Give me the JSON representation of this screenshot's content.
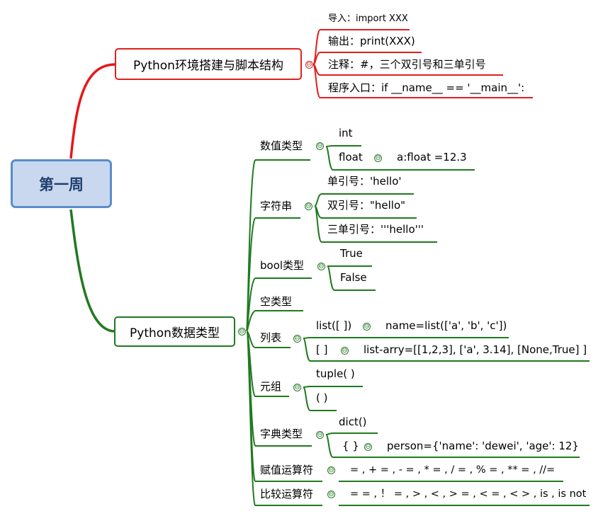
{
  "root": {
    "label": "第一周"
  },
  "branch1": {
    "label": "Python环境搭建与脚本结构",
    "items": [
      "导入：import XXX",
      "输出：print(XXX)",
      "注释：#，三个双引号和三单引号",
      "程序入口：if __name__ == '__main__':"
    ]
  },
  "branch2": {
    "label": "Python数据类型",
    "numeric": {
      "label": "数值类型",
      "int": "int",
      "float": "float",
      "float_example": "a:float =12.3"
    },
    "string": {
      "label": "字符串",
      "single": "单引号：'hello'",
      "double": "双引号：\"hello\"",
      "triple": "三单引号：'''hello'''"
    },
    "bool": {
      "label": "bool类型",
      "true": "True",
      "false": "False"
    },
    "none": {
      "label": "空类型"
    },
    "list": {
      "label": "列表",
      "ctor": "list([ ])",
      "ctor_example": "name=list(['a', 'b', 'c'])",
      "literal": "[ ]",
      "literal_example": "list-arry=[[1,2,3], ['a', 3.14], [None,True] ]"
    },
    "tuple": {
      "label": "元组",
      "ctor": "tuple( )",
      "literal": "( )"
    },
    "dict": {
      "label": "字典类型",
      "ctor": "dict()",
      "literal": "{ }",
      "literal_example": "person={'name': 'dewei', 'age': 12}"
    },
    "assign": {
      "label": "赋值运算符",
      "ops": "= ,  + = ,  - = ,  * = ,  / = ,  % = ,  ** = ,  //="
    },
    "compare": {
      "label": "比较运算符",
      "ops": "= = ,  ！ = ,  > ,  < ,  > = ,  < = ,  < > ,  is ,  is not"
    }
  },
  "collapse_symbol": "⊖",
  "colors": {
    "branch1": "#e02020",
    "branch2": "#1f7a1f",
    "root_fill": "#c9d8ee",
    "root_border": "#5b8ccc"
  }
}
